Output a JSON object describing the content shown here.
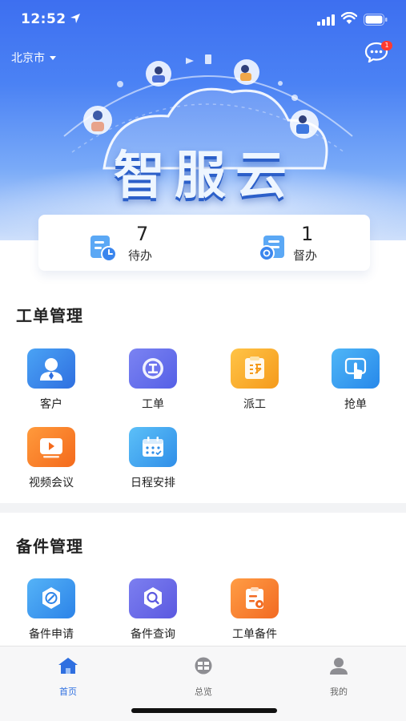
{
  "status_bar": {
    "time": "12:52"
  },
  "header": {
    "city": "北京市",
    "message_badge": "1"
  },
  "hero": {
    "brand_title": "智服云"
  },
  "stats": [
    {
      "count": "7",
      "label": "待办"
    },
    {
      "count": "1",
      "label": "督办"
    }
  ],
  "work_order_section": {
    "title": "工单管理",
    "items": [
      {
        "label": "客户",
        "icon": "customer-icon",
        "colors": [
          "#4aa3f5",
          "#2f6fe0"
        ]
      },
      {
        "label": "工单",
        "icon": "work-order-icon",
        "colors": [
          "#7b83f2",
          "#5560e6"
        ]
      },
      {
        "label": "派工",
        "icon": "dispatch-icon",
        "colors": [
          "#ffc447",
          "#f59a1b"
        ]
      },
      {
        "label": "抢单",
        "icon": "grab-order-icon",
        "colors": [
          "#4fb6f7",
          "#2788ea"
        ]
      },
      {
        "label": "视频会议",
        "icon": "video-meeting-icon",
        "colors": [
          "#ff9a3c",
          "#f46a1c"
        ]
      },
      {
        "label": "日程安排",
        "icon": "schedule-icon",
        "colors": [
          "#5cc0f8",
          "#2f8ee8"
        ]
      }
    ]
  },
  "spare_parts_section": {
    "title": "备件管理",
    "items": [
      {
        "label": "备件申请",
        "icon": "spare-apply-icon",
        "colors": [
          "#55b3f7",
          "#2c83e8"
        ]
      },
      {
        "label": "备件查询",
        "icon": "spare-query-icon",
        "colors": [
          "#7c7ff0",
          "#5b59e0"
        ]
      },
      {
        "label": "工单备件",
        "icon": "order-spare-icon",
        "colors": [
          "#ff9d45",
          "#f26a22"
        ]
      }
    ]
  },
  "tabbar": {
    "items": [
      {
        "label": "首页",
        "icon": "home-icon",
        "active": true
      },
      {
        "label": "总览",
        "icon": "overview-icon",
        "active": false
      },
      {
        "label": "我的",
        "icon": "profile-icon",
        "active": false
      }
    ],
    "active_color": "#2f6fe0",
    "inactive_color": "#666666"
  }
}
